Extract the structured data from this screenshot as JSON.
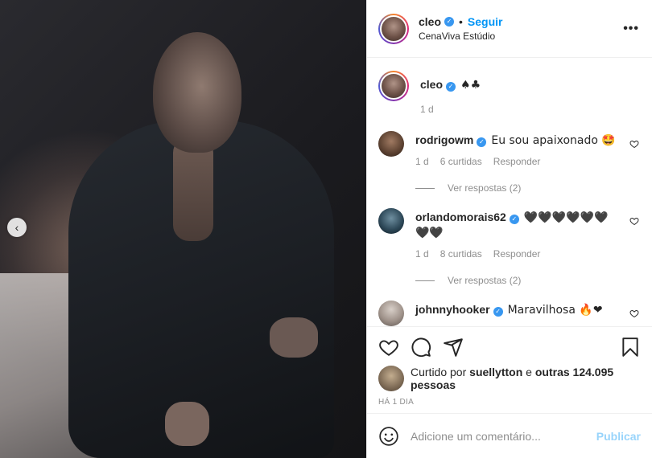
{
  "post": {
    "author": "cleo",
    "follow_label": "Seguir",
    "dot": "•",
    "location": "CenaViva Estúdio",
    "more_label": "•••",
    "prev_label": "‹"
  },
  "caption": {
    "username": "cleo",
    "text": "♠♣",
    "time": "1 d"
  },
  "comments": [
    {
      "username": "rodrigowm",
      "text": "Eu sou apaixonado 🤩",
      "time": "1 d",
      "likes": "6 curtidas",
      "reply": "Responder",
      "view_replies": "Ver respostas (2)"
    },
    {
      "username": "orlandomorais62",
      "text": "🖤🖤🖤🖤🖤🖤🖤🖤",
      "time": "1 d",
      "likes": "8 curtidas",
      "reply": "Responder",
      "view_replies": "Ver respostas (2)"
    },
    {
      "username": "johnnyhooker",
      "text": "Maravilhosa 🔥❤"
    }
  ],
  "likes": {
    "prefix": "Curtido por",
    "liker": "suellytton",
    "middle": "e",
    "others": "outras 124.095 pessoas"
  },
  "timestamp": "Há 1 dia",
  "add_comment": {
    "placeholder": "Adicione um comentário...",
    "publish": "Publicar"
  },
  "icons": {
    "like": "heart-icon",
    "comment": "comment-icon",
    "share": "paper-plane-icon",
    "save": "bookmark-icon",
    "emoji": "smiley-icon",
    "verified": "verified-badge-icon"
  },
  "colors": {
    "accent": "#0095f6",
    "verified": "#3897f0",
    "secondary_text": "#8e8e8e"
  }
}
